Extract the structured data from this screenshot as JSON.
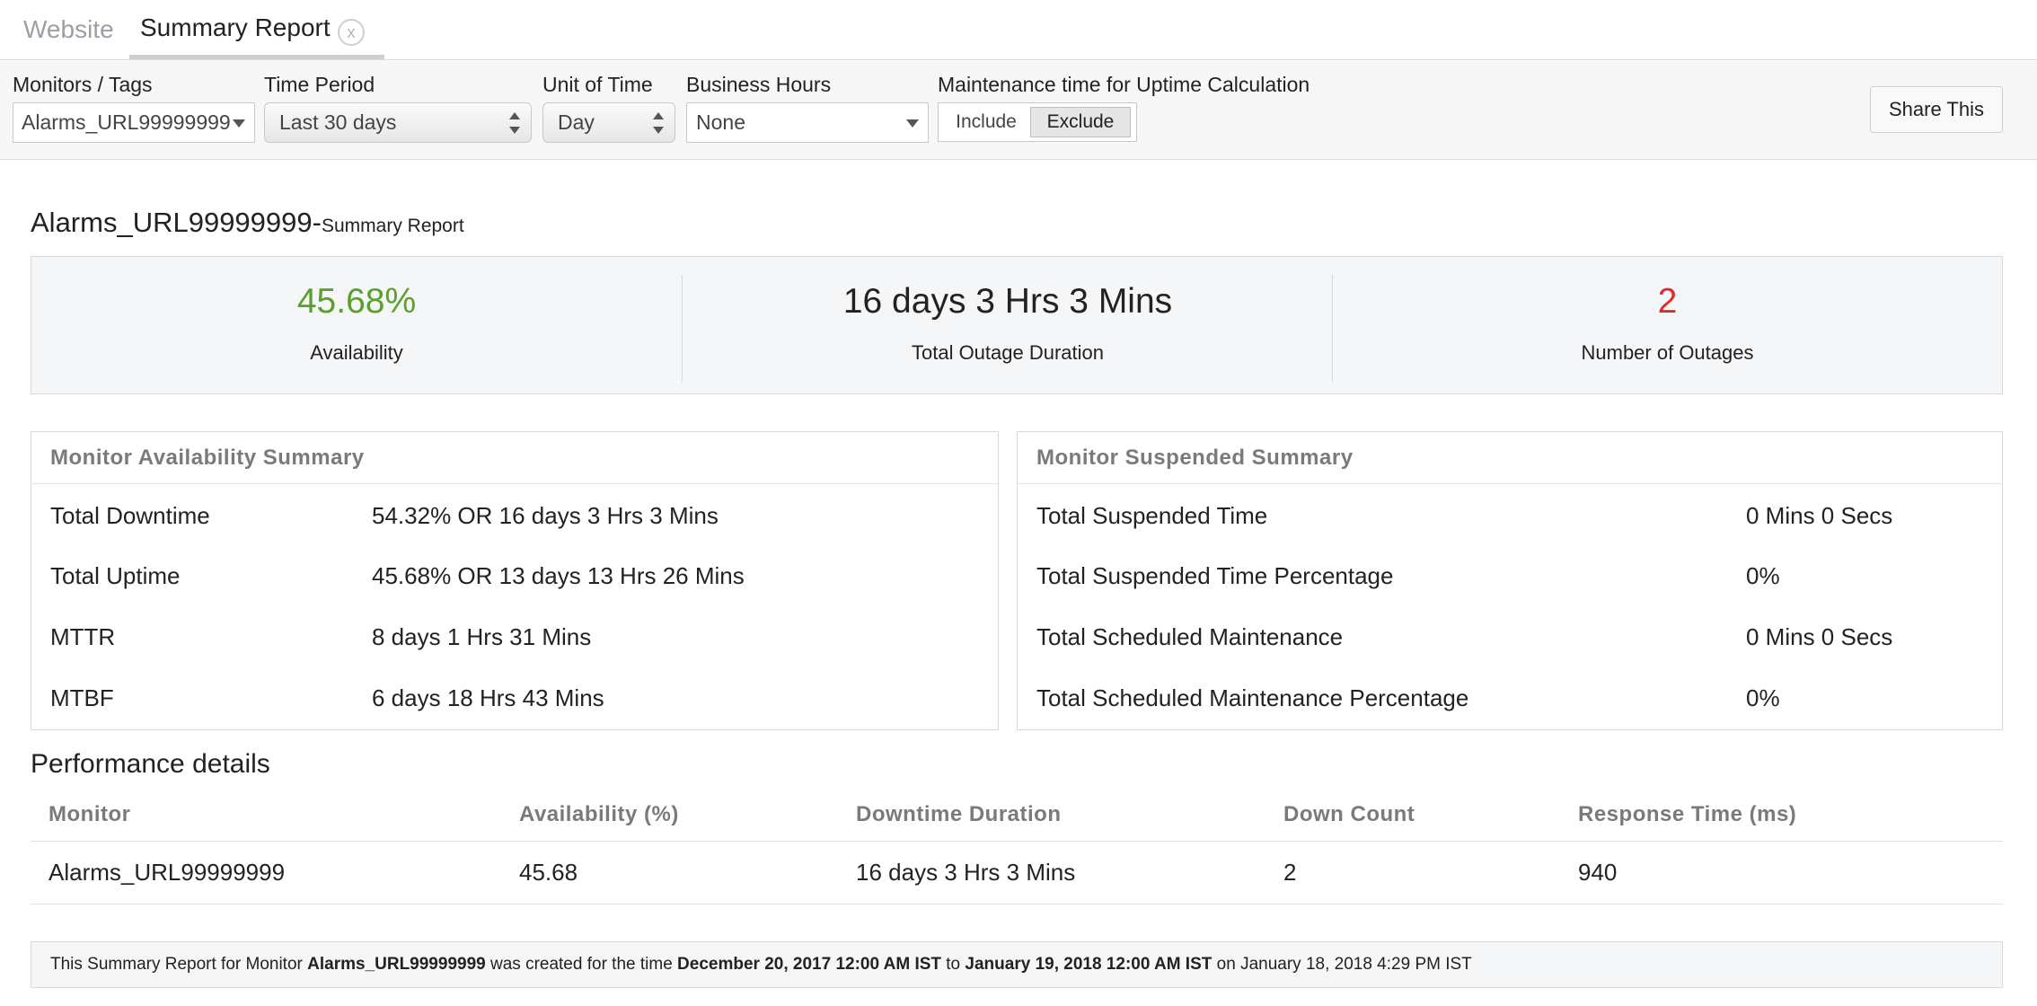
{
  "tabs": {
    "website": "Website",
    "summary": "Summary Report",
    "close_glyph": "x"
  },
  "filters": {
    "monitors_label": "Monitors / Tags",
    "monitors_value": "Alarms_URL99999999",
    "time_period_label": "Time Period",
    "time_period_value": "Last 30 days",
    "unit_label": "Unit of Time",
    "unit_value": "Day",
    "business_hours_label": "Business Hours",
    "business_hours_value": "None",
    "maintenance_label": "Maintenance time for Uptime Calculation",
    "include_label": "Include",
    "exclude_label": "Exclude",
    "selected_option": "Exclude",
    "share_label": "Share This"
  },
  "report": {
    "monitor_name": "Alarms_URL99999999",
    "separator": " - ",
    "subtitle": "Summary Report"
  },
  "stats": {
    "availability_value": "45.68%",
    "availability_label": "Availability",
    "availability_color": "#5aa02c",
    "outage_duration_value": "16 days 3 Hrs 3 Mins",
    "outage_duration_label": "Total Outage Duration",
    "outages_value": "2",
    "outages_label": "Number of Outages",
    "outages_color": "#e02b2b"
  },
  "availability_summary": {
    "title": "Monitor Availability Summary",
    "rows": [
      {
        "label": "Total Downtime",
        "value": "54.32% OR 16 days 3 Hrs 3 Mins"
      },
      {
        "label": "Total Uptime",
        "value": "45.68% OR 13 days 13 Hrs 26 Mins"
      },
      {
        "label": "MTTR",
        "value": "8 days 1 Hrs 31 Mins"
      },
      {
        "label": "MTBF",
        "value": "6 days 18 Hrs 43 Mins"
      }
    ]
  },
  "suspended_summary": {
    "title": "Monitor Suspended Summary",
    "rows": [
      {
        "label": "Total Suspended Time",
        "value": "0 Mins 0 Secs"
      },
      {
        "label": "Total Suspended Time Percentage",
        "value": "0%"
      },
      {
        "label": "Total Scheduled Maintenance",
        "value": "0 Mins 0 Secs"
      },
      {
        "label": "Total Scheduled Maintenance Percentage",
        "value": "0%"
      }
    ]
  },
  "performance": {
    "title": "Performance details",
    "columns": [
      "Monitor",
      "Availability (%)",
      "Downtime Duration",
      "Down Count",
      "Response Time (ms)"
    ],
    "rows": [
      [
        "Alarms_URL99999999",
        "45.68",
        "16 days 3 Hrs 3 Mins",
        "2",
        "940"
      ]
    ]
  },
  "footer": {
    "part1": "This Summary Report for Monitor ",
    "monitor": "Alarms_URL99999999",
    "part2": " was created for the time ",
    "start": "December 20, 2017 12:00 AM IST",
    "part3": " to ",
    "end": "January 19, 2018 12:00 AM IST",
    "part4": " on January 18, 2018 4:29 PM IST"
  }
}
